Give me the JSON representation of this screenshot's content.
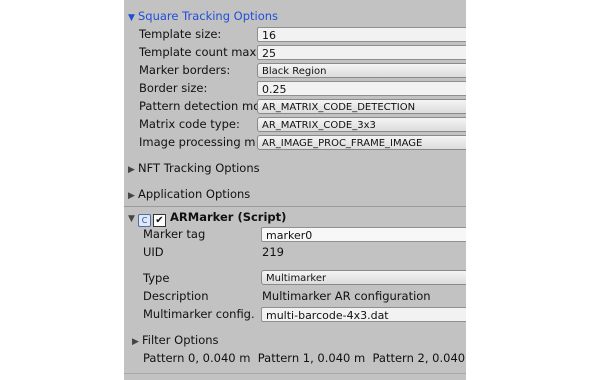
{
  "square_tracking": {
    "header": "Square Tracking Options",
    "template_size_label": "Template size:",
    "template_size_value": "16",
    "template_count_label": "Template count max",
    "template_count_value": "25",
    "marker_borders_label": "Marker borders:",
    "marker_borders_value": "Black Region",
    "border_size_label": "Border size:",
    "border_size_value": "0.25",
    "pattern_detection_label": "Pattern detection mo",
    "pattern_detection_value": "AR_MATRIX_CODE_DETECTION",
    "matrix_code_label": "Matrix code type:",
    "matrix_code_value": "AR_MATRIX_CODE_3x3",
    "image_processing_label": "Image processing m",
    "image_processing_value": "AR_IMAGE_PROC_FRAME_IMAGE"
  },
  "nft_tracking": {
    "header": "NFT Tracking Options"
  },
  "application": {
    "header": "Application Options"
  },
  "armarker": {
    "header": "ARMarker (Script)",
    "marker_tag_label": "Marker tag",
    "marker_tag_value": "marker0",
    "uid_label": "UID",
    "uid_value": "219",
    "type_label": "Type",
    "type_value": "Multimarker",
    "description_label": "Description",
    "description_value": "Multimarker AR configuration",
    "config_label": "Multimarker config.",
    "config_value": "multi-barcode-4x3.dat"
  },
  "filter": {
    "header": "Filter Options"
  },
  "patterns": {
    "p0": "Pattern 0, 0.040 m",
    "p1": "Pattern 1, 0.040 m",
    "p2": "Pattern 2, 0.040"
  }
}
